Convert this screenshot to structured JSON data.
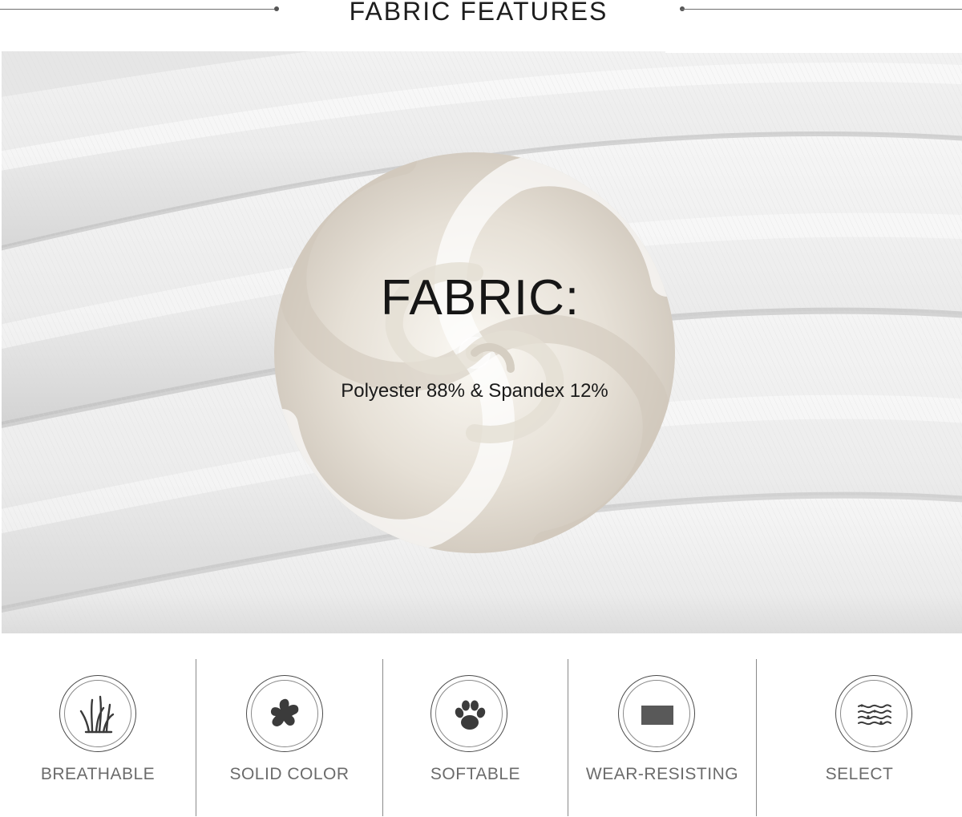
{
  "header": {
    "title": "FABRIC FEATURES"
  },
  "fabric": {
    "heading": "FABRIC:",
    "composition": "Polyester 88% & Spandex 12%"
  },
  "features": [
    {
      "label": "BREATHABLE",
      "icon": "grass-icon"
    },
    {
      "label": "SOLID COLOR",
      "icon": "color-splash-icon"
    },
    {
      "label": "SOFTABLE",
      "icon": "paw-print-icon"
    },
    {
      "label": "WEAR-RESISTING",
      "icon": "fabric-swatch-icon"
    },
    {
      "label": "SELECT",
      "icon": "fabric-layers-icon"
    }
  ],
  "colors": {
    "title_text": "#1d1d1d",
    "label_text": "#6b6b6b",
    "fabric_base": "#e9e9e9"
  }
}
